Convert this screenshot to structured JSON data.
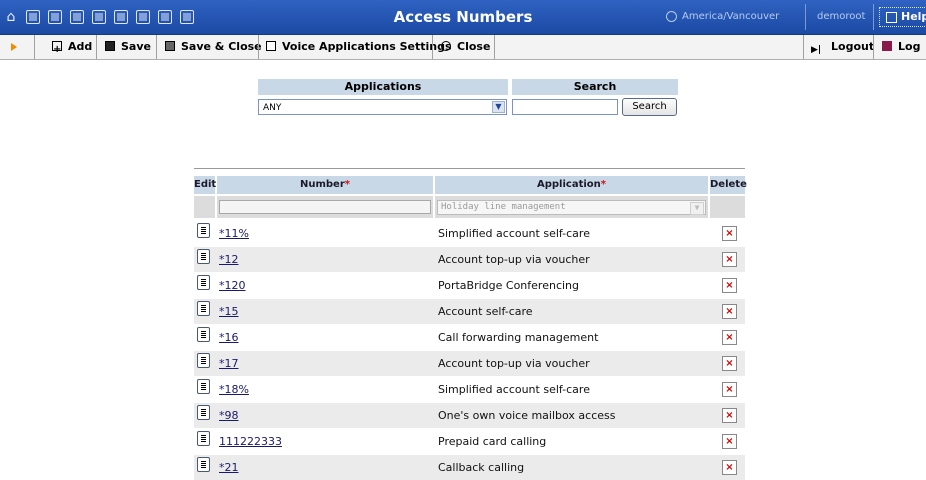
{
  "header": {
    "title": "Access Numbers",
    "timezone": "America/Vancouver",
    "user": "demoroot",
    "help_label": "Help",
    "nav_icons": [
      "home-icon",
      "list-icon",
      "dollar-icon",
      "grid-icon",
      "person-icon",
      "hierarchy-icon",
      "forward-icon",
      "chart-icon",
      "search-icon"
    ]
  },
  "toolbar": {
    "add_label": "Add",
    "save_label": "Save",
    "save_close_label": "Save & Close",
    "voice_apps_label": "Voice Applications Settings",
    "close_label": "Close",
    "logout_label": "Logout",
    "log_label": "Log"
  },
  "filter": {
    "applications_header": "Applications",
    "search_header": "Search",
    "applications_value": "ANY",
    "search_value": "",
    "search_button": "Search"
  },
  "table": {
    "headers": {
      "edit": "Edit",
      "number": "Number",
      "application": "Application",
      "delete": "Delete",
      "required_mark": "*"
    },
    "filter_application_placeholder": "Holiday line management",
    "rows": [
      {
        "number": "*11%",
        "application": "Simplified account self-care"
      },
      {
        "number": "*12",
        "application": "Account top-up via voucher"
      },
      {
        "number": "*120",
        "application": "PortaBridge Conferencing"
      },
      {
        "number": "*15",
        "application": "Account self-care"
      },
      {
        "number": "*16",
        "application": "Call forwarding management"
      },
      {
        "number": "*17",
        "application": "Account top-up via voucher"
      },
      {
        "number": "*18%",
        "application": "Simplified account self-care"
      },
      {
        "number": "*98",
        "application": "One's own voice mailbox access"
      },
      {
        "number": "111222333",
        "application": "Prepaid card calling"
      },
      {
        "number": "*21",
        "application": "Callback calling"
      }
    ],
    "delete_glyph": "×"
  },
  "colors": {
    "header_blue": "#2456b8",
    "table_header": "#c9d8e6",
    "delete_red": "#d40000"
  }
}
